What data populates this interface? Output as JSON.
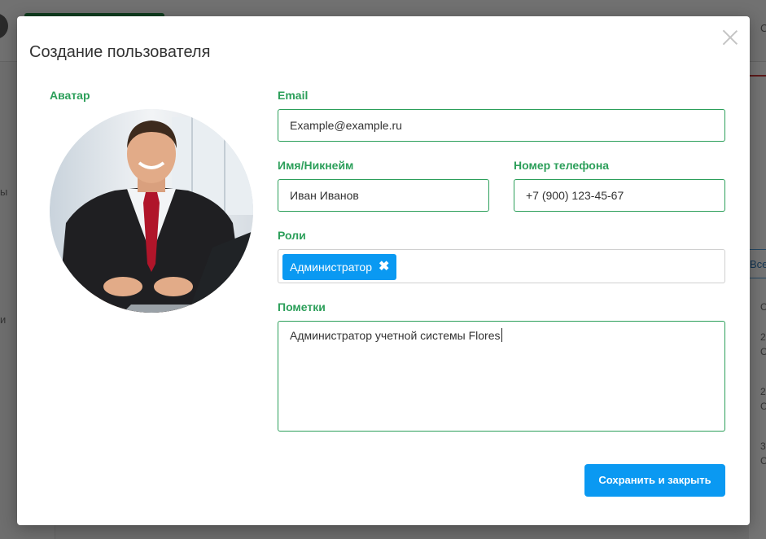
{
  "background": {
    "side_text_1": "ы",
    "side_text_2": "и",
    "right_top_text": "С",
    "filter_button_label": "Все",
    "row_texts": [
      "С",
      "2",
      "С",
      "2",
      "С",
      "3",
      "С"
    ]
  },
  "modal": {
    "title": "Создание пользователя",
    "close_icon": "close-icon"
  },
  "avatar": {
    "label": "Аватар"
  },
  "form": {
    "email": {
      "label": "Email",
      "value": "Example@example.ru"
    },
    "name": {
      "label": "Имя/Никнейм",
      "value": "Иван Иванов"
    },
    "phone": {
      "label": "Номер телефона",
      "value": "+7 (900) 123-45-67"
    },
    "roles": {
      "label": "Роли",
      "items": [
        {
          "label": "Администратор",
          "remove_icon": "✖"
        }
      ]
    },
    "notes": {
      "label": "Пометки",
      "value": "Администратор учетной системы Flores"
    }
  },
  "actions": {
    "save_label": "Сохранить и закрыть"
  },
  "colors": {
    "accent_green": "#2c9f5a",
    "primary_blue": "#0a99f2"
  }
}
